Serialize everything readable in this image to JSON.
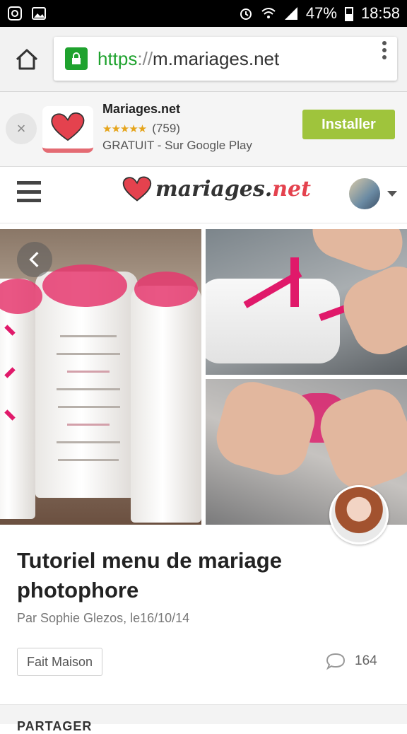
{
  "status_bar": {
    "battery": "47%",
    "time": "18:58"
  },
  "browser": {
    "url_scheme": "https",
    "url_sep": "://",
    "url_host": "m.mariages.net"
  },
  "app_banner": {
    "name": "Mariages.net",
    "stars": "★★★★★",
    "rating_count": "(759)",
    "subtitle": "GRATUIT - Sur Google Play",
    "install_label": "Installer",
    "close_glyph": "×"
  },
  "site_header": {
    "logo_main": "mariages.",
    "logo_net": "net"
  },
  "article": {
    "title": "Tutoriel menu de mariage photophore",
    "byline": "Par Sophie Glezos, le16/10/14",
    "tag": "Fait Maison",
    "comment_count": "164"
  },
  "bottom": {
    "label": "PARTAGER"
  },
  "colors": {
    "accent_green": "#9fc43c",
    "brand_red": "#e4424e",
    "ribbon_pink": "#e0196a"
  }
}
